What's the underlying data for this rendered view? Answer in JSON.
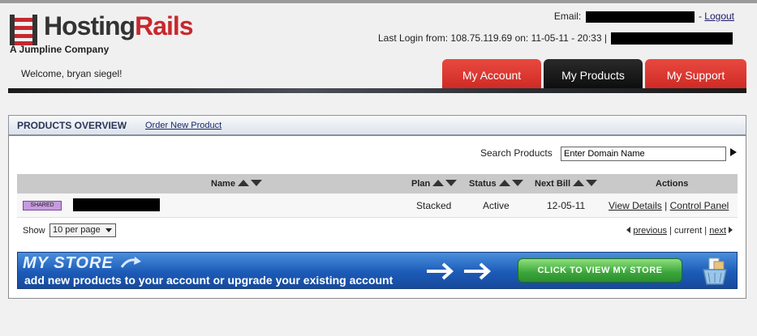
{
  "brand": {
    "name_part1": "Hosting",
    "name_part2": "Rails",
    "tagline": "A Jumpline Company",
    "accent_color": "#c8282d"
  },
  "account": {
    "email_label": "Email:",
    "logout_label": "Logout",
    "last_login": "Last Login from: 108.75.119.69 on: 11-05-11 - 20:33 |",
    "welcome": "Welcome, bryan siegel!"
  },
  "nav": {
    "tabs": [
      {
        "label": "My Account",
        "active": false
      },
      {
        "label": "My Products",
        "active": true
      },
      {
        "label": "My Support",
        "active": false
      }
    ]
  },
  "products": {
    "title": "PRODUCTS OVERVIEW",
    "order_link": "Order New Product",
    "search_label": "Search Products",
    "search_value": "Enter Domain Name",
    "columns": [
      "Name",
      "Plan",
      "Status",
      "Next Bill",
      "Actions"
    ],
    "rows": [
      {
        "badge": "SHARED",
        "plan": "Stacked",
        "status": "Active",
        "next_bill": "12-05-11",
        "action_details": "View Details",
        "action_separator": "|",
        "action_panel": "Control Panel"
      }
    ],
    "pager": {
      "show_label": "Show",
      "per_page": "10 per page",
      "previous": "previous",
      "current": "current",
      "next": "next",
      "separator": "|"
    }
  },
  "banner": {
    "title": "MY STORE",
    "subtitle": "add new products to your account or  upgrade your existing account",
    "cta": "CLICK TO VIEW MY STORE"
  }
}
